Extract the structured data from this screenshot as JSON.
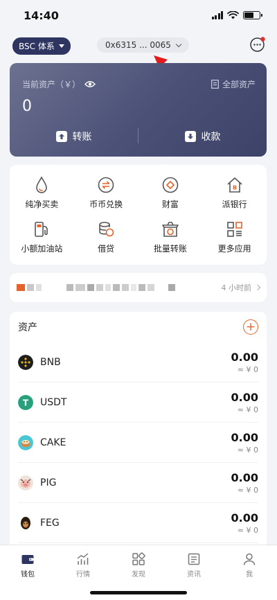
{
  "status": {
    "time": "14:40"
  },
  "topbar": {
    "chain": "BSC 体系",
    "address": "0x6315 ... 0065"
  },
  "asset_card": {
    "label": "当前资产（￥）",
    "all_assets": "全部资产",
    "amount": "0",
    "transfer": "转账",
    "receive": "收款"
  },
  "quick": [
    {
      "label": "纯净买卖",
      "icon": "drop-icon"
    },
    {
      "label": "币币兑换",
      "icon": "swap-icon"
    },
    {
      "label": "财富",
      "icon": "diamond-icon"
    },
    {
      "label": "派银行",
      "icon": "bank-icon"
    },
    {
      "label": "小额加油站",
      "icon": "gas-station-icon"
    },
    {
      "label": "借贷",
      "icon": "coins-icon"
    },
    {
      "label": "批量转账",
      "icon": "batch-box-icon"
    },
    {
      "label": "更多应用",
      "icon": "apps-icon"
    }
  ],
  "news": {
    "time": "4 小时前"
  },
  "assets": {
    "title": "资产",
    "tokens": [
      {
        "symbol": "BNB",
        "balance": "0.00",
        "fiat": "≈ ¥ 0",
        "color": "#1e1e1e"
      },
      {
        "symbol": "USDT",
        "balance": "0.00",
        "fiat": "≈ ¥ 0",
        "color": "#26a17b"
      },
      {
        "symbol": "CAKE",
        "balance": "0.00",
        "fiat": "≈ ¥ 0",
        "color": "#49c8d4"
      },
      {
        "symbol": "PIG",
        "balance": "0.00",
        "fiat": "≈ ¥ 0",
        "color": "#c9a9a0"
      },
      {
        "symbol": "FEG",
        "balance": "0.00",
        "fiat": "≈ ¥ 0",
        "color": "#3a2a18"
      }
    ]
  },
  "tabs": [
    {
      "label": "钱包",
      "icon": "wallet-icon",
      "active": true
    },
    {
      "label": "行情",
      "icon": "chart-icon",
      "active": false
    },
    {
      "label": "发现",
      "icon": "discover-icon",
      "active": false
    },
    {
      "label": "资讯",
      "icon": "news-icon",
      "active": false
    },
    {
      "label": "我",
      "icon": "profile-icon",
      "active": false
    }
  ]
}
